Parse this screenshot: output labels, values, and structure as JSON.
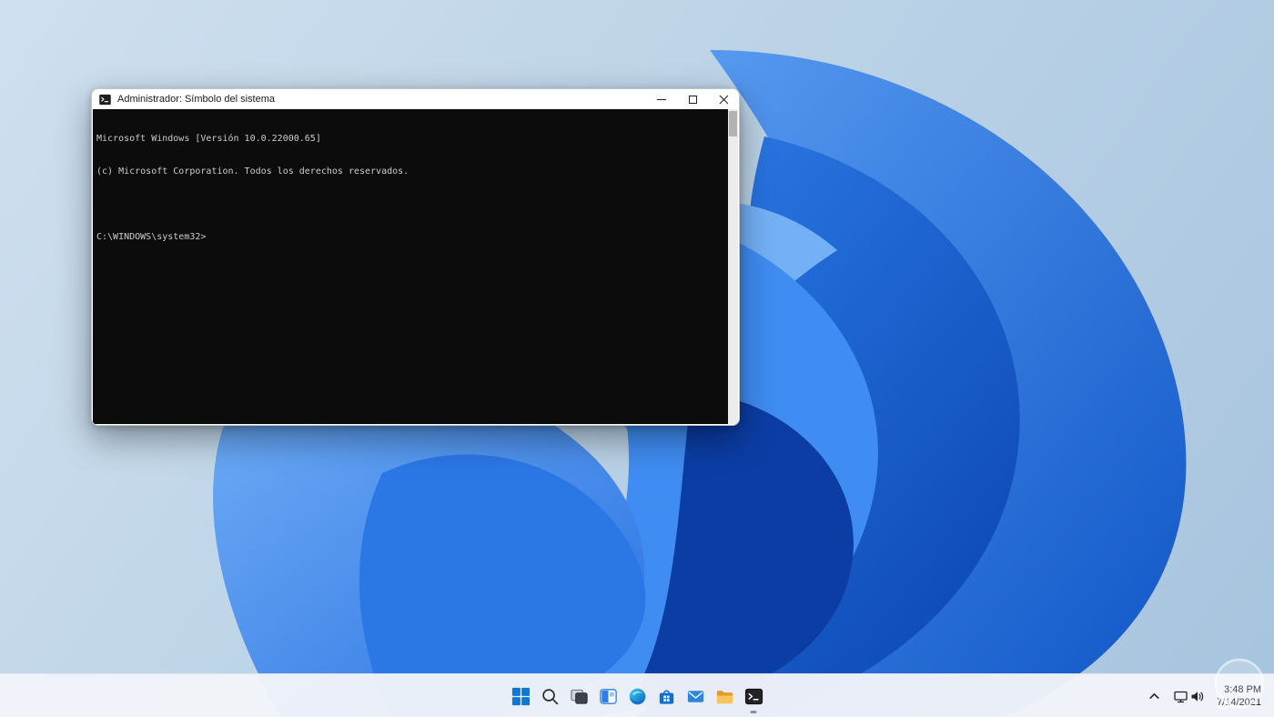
{
  "cmd_window": {
    "title": "Administrador: Símbolo del sistema",
    "terminal_lines": [
      "Microsoft Windows [Versión 10.0.22000.65]",
      "(c) Microsoft Corporation. Todos los derechos reservados.",
      "",
      "C:\\WINDOWS\\system32>"
    ]
  },
  "taskbar": {
    "pinned_icons": [
      "start",
      "search",
      "task-view",
      "widgets",
      "edge",
      "microsoft-store",
      "mail",
      "file-explorer",
      "command-prompt"
    ],
    "active_app": "command-prompt",
    "tray": {
      "icons": [
        "chevron-up",
        "network",
        "volume"
      ],
      "time": "3:48 PM",
      "date": "7/14/2021"
    }
  },
  "colors": {
    "accent_blue": "#0b78d4",
    "taskbar_bg": "#f1f4f9",
    "terminal_bg": "#0c0c0c",
    "terminal_fg": "#cccccc",
    "wallpaper_blue": "#2b7ae8"
  }
}
